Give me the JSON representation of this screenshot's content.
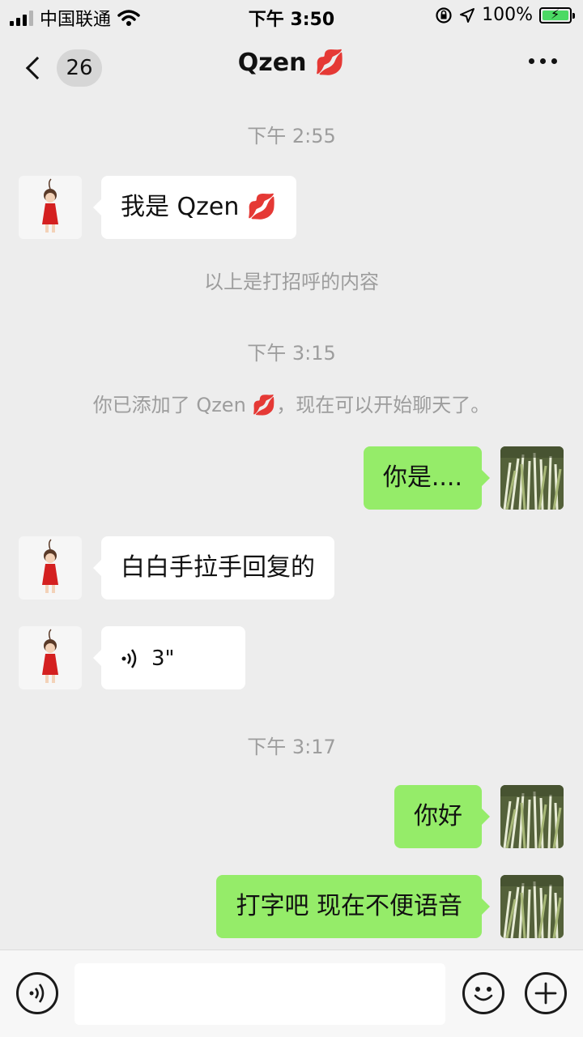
{
  "status_bar": {
    "carrier": "中国联通",
    "time": "下午 3:50",
    "battery_percent": "100%"
  },
  "nav": {
    "unread_count": "26",
    "title": "Qzen 💋"
  },
  "chat": {
    "time_1": "下午 2:55",
    "msg_1": "我是 Qzen 💋",
    "system_1": "以上是打招呼的内容",
    "time_2": "下午 3:15",
    "system_2": "你已添加了 Qzen 💋，现在可以开始聊天了。",
    "msg_2": "你是....",
    "msg_3": "白白手拉手回复的",
    "voice_duration": "3\"",
    "time_3": "下午 3:17",
    "msg_4": "你好",
    "msg_5": "打字吧 现在不便语音"
  },
  "input_bar": {
    "placeholder": ""
  },
  "colors": {
    "background": "#ededed",
    "outgoing_bubble": "#95ec69",
    "incoming_bubble": "#ffffff",
    "timestamp": "#9d9d9d"
  },
  "icons": [
    "back-chevron-icon",
    "voice-icon",
    "emoji-icon",
    "plus-icon",
    "more-icon",
    "wifi-icon",
    "location-icon",
    "lock-rotation-icon",
    "battery-icon"
  ]
}
